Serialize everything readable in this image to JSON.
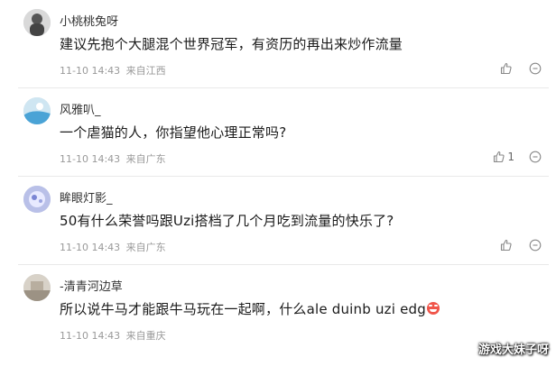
{
  "comments": [
    {
      "username": "小桃桃兔呀",
      "content": "建议先抱个大腿混个世界冠军，有资历的再出来炒作流量",
      "time": "11-10 14:43",
      "location": "来自江西",
      "likes": "",
      "avatar_icon": "user-avatar-icon",
      "like_icon": "thumbs-up-icon",
      "reply_icon": "comment-bubble-icon"
    },
    {
      "username": "风雅叭_",
      "content": "一个虐猫的人，你指望他心理正常吗?",
      "time": "11-10 14:43",
      "location": "来自广东",
      "likes": "1",
      "avatar_icon": "user-avatar-icon",
      "like_icon": "thumbs-up-icon",
      "reply_icon": "comment-bubble-icon"
    },
    {
      "username": "眸眼灯影_",
      "content": "50有什么荣誉吗跟Uzi搭档了几个月吃到流量的快乐了?",
      "time": "11-10 14:43",
      "location": "来自广东",
      "likes": "",
      "avatar_icon": "user-avatar-icon",
      "like_icon": "thumbs-up-icon",
      "reply_icon": "comment-bubble-icon"
    },
    {
      "username": "-清青河边草",
      "content": "所以说牛马才能跟牛马玩在一起啊，什么ale duinb uzi edg",
      "time": "11-10 14:43",
      "location": "来自重庆",
      "likes": "",
      "avatar_icon": "user-avatar-icon",
      "like_icon": "thumbs-up-icon",
      "reply_icon": "comment-bubble-icon",
      "emoji_icon": "laughing-emoji-icon"
    }
  ],
  "watermark": "游戏大妹子呀",
  "colors": {
    "text_primary": "#1a1a1a",
    "text_meta": "#999999",
    "divider": "#e9e9e9",
    "emoji": "#f0554a"
  }
}
